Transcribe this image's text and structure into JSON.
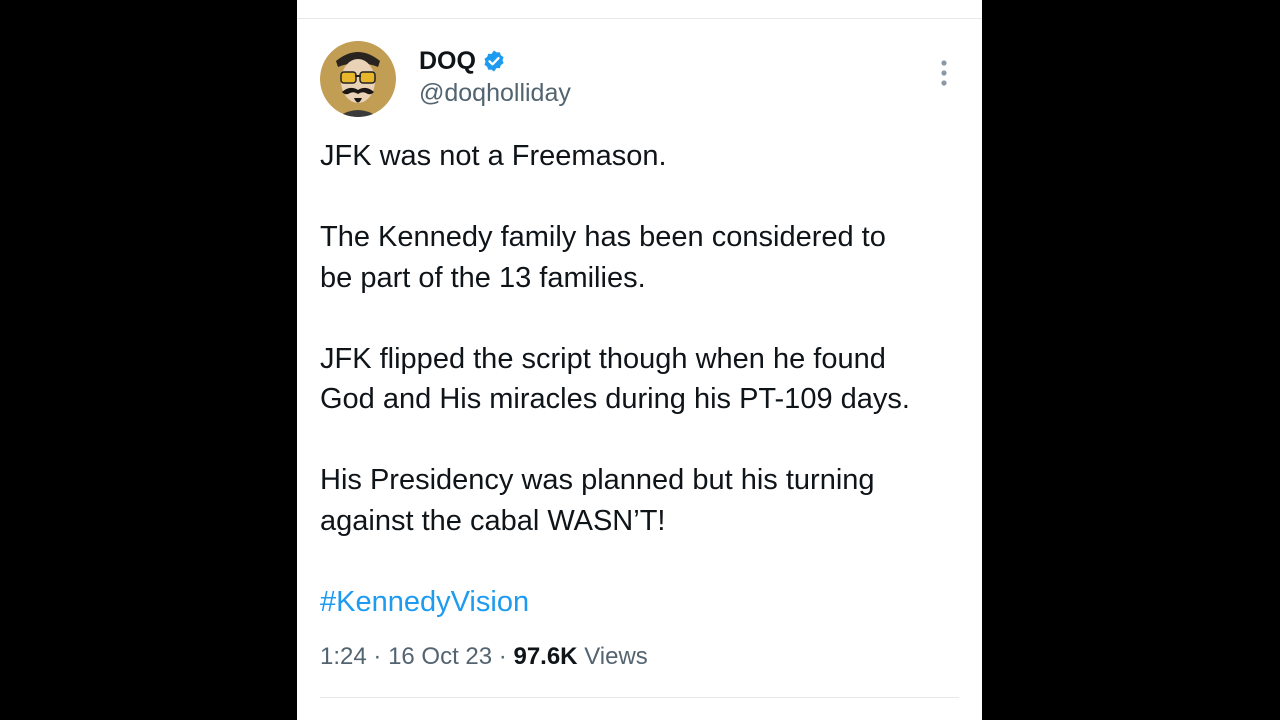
{
  "author": {
    "display_name": "DOQ",
    "handle": "@doqholliday",
    "verified": true,
    "avatar_icon": "mustached-man-sunglasses-avatar"
  },
  "tweet": {
    "paragraphs": [
      [
        "JFK was not a Freemason."
      ],
      [
        "The Kennedy family has been considered to",
        "be part of the 13 families."
      ],
      [
        "JFK flipped the script though when he found",
        "God and His miracles during his PT-109 days."
      ],
      [
        "His Presidency was planned but his turning",
        "against the cabal WASN’T!"
      ]
    ],
    "hashtag": "#KennedyVision"
  },
  "meta": {
    "time": "1:24",
    "separator": "·",
    "date": "16 Oct 23",
    "views_count": "97.6K",
    "views_label": "Views"
  },
  "colors": {
    "background": "#000000",
    "card": "#ffffff",
    "text_primary": "#0f1419",
    "text_secondary": "#536471",
    "accent": "#1d9bf0"
  }
}
